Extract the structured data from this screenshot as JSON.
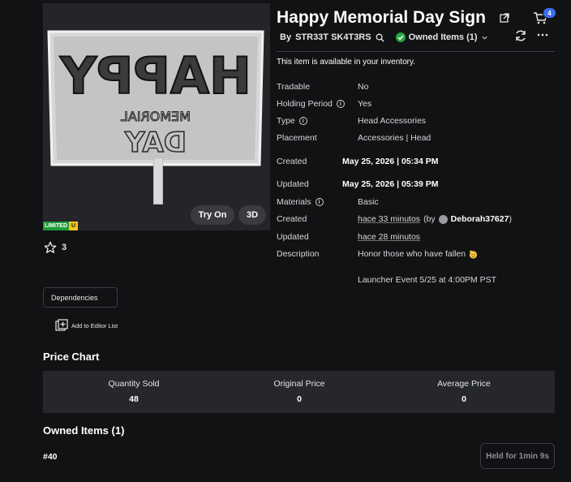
{
  "item": {
    "title": "Happy Memorial Day Sign",
    "creator": "STR33T SK4T3RS",
    "owned_label": "Owned Items (1)",
    "availability": "This item is available in your inventory.",
    "favorites": "3",
    "cart_count": "4"
  },
  "thumbnail": {
    "try_on_label": "Try On",
    "three_d_label": "3D",
    "limited_label": "LIMITED",
    "limited_u": "U",
    "sign_big_text": "HAPPY",
    "sign_small_text_1": "MEMORIAL",
    "sign_small_text_2": "DAY"
  },
  "details": [
    {
      "label": "Tradable",
      "value": "No"
    },
    {
      "label": "Holding Period",
      "value": "Yes"
    },
    {
      "label": "Type",
      "value": "Head Accessories"
    },
    {
      "label": "Placement",
      "value": "Accessories | Head"
    },
    {
      "label": "Created",
      "value": "May 25, 2026 | 05:34 PM"
    },
    {
      "label": "Updated",
      "value": "May 25, 2026 | 05:39 PM"
    },
    {
      "label": "Materials",
      "value": "Basic"
    },
    {
      "label": "Created",
      "value": "hace 33 minutos",
      "by_prefix": "(by",
      "by_user": "Deborah37627",
      "by_suffix": ")"
    },
    {
      "label": "Updated",
      "value": "hace 28 minutos"
    },
    {
      "label": "Description",
      "value": "Honor those who have fallen",
      "value_line2": "Launcher Event 5/25 at 4:00PM PST"
    }
  ],
  "actions": {
    "dependencies_label": "Dependencies",
    "editor_list_label": "Add to Editor List"
  },
  "price_chart": {
    "title": "Price Chart",
    "columns": [
      {
        "header": "Quantity Sold",
        "value": "48"
      },
      {
        "header": "Original Price",
        "value": "0"
      },
      {
        "header": "Average Price",
        "value": "0"
      }
    ]
  },
  "owned_items": {
    "title": "Owned Items (1)",
    "serial": "#40",
    "held_label": "Held for 1min 9s"
  },
  "colors": {
    "background": "#111214",
    "panel": "#25272c",
    "accent": "#3a6df0",
    "owned_check": "#28a745"
  }
}
